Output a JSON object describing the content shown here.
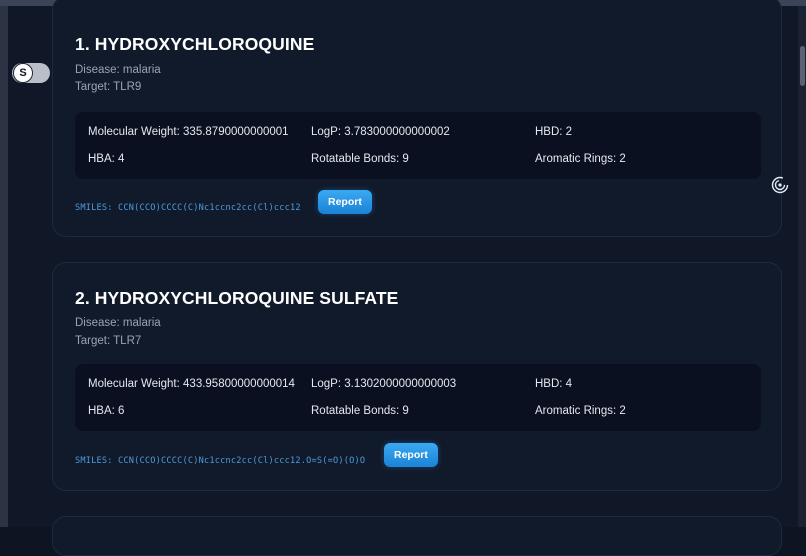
{
  "compounds": [
    {
      "title": "1. HYDROXYCHLOROQUINE",
      "disease": "Disease: malaria",
      "target": "Target: TLR9",
      "molecular_weight": "Molecular Weight: 335.8790000000001",
      "logp": "LogP: 3.783000000000002",
      "hbd": "HBD: 2",
      "hba": "HBA: 4",
      "rotatable_bonds": "Rotatable Bonds: 9",
      "aromatic_rings": "Aromatic Rings: 2",
      "smiles": "SMILES: CCN(CCO)CCCC(C)Nc1ccnc2cc(Cl)ccc12",
      "report_label": "Report"
    },
    {
      "title": "2. HYDROXYCHLOROQUINE SULFATE",
      "disease": "Disease: malaria",
      "target": "Target: TLR7",
      "molecular_weight": "Molecular Weight: 433.95800000000014",
      "logp": "LogP: 3.1302000000000003",
      "hbd": "HBD: 4",
      "hba": "HBA: 6",
      "rotatable_bonds": "Rotatable Bonds: 9",
      "aromatic_rings": "Aromatic Rings: 2",
      "smiles": "SMILES: CCN(CCO)CCCC(C)Nc1ccnc2cc(Cl)ccc12.O=S(=O)(O)O",
      "report_label": "Report"
    }
  ],
  "toggle": {
    "letter": "S"
  },
  "icons": {
    "toggle": "s-logo-icon",
    "side": "spiral-icon"
  },
  "colors": {
    "background": "#101827",
    "card": "#111a2b",
    "panel": "#0a1020",
    "accent": "#2196e6",
    "smiles": "#4d9bdc"
  }
}
